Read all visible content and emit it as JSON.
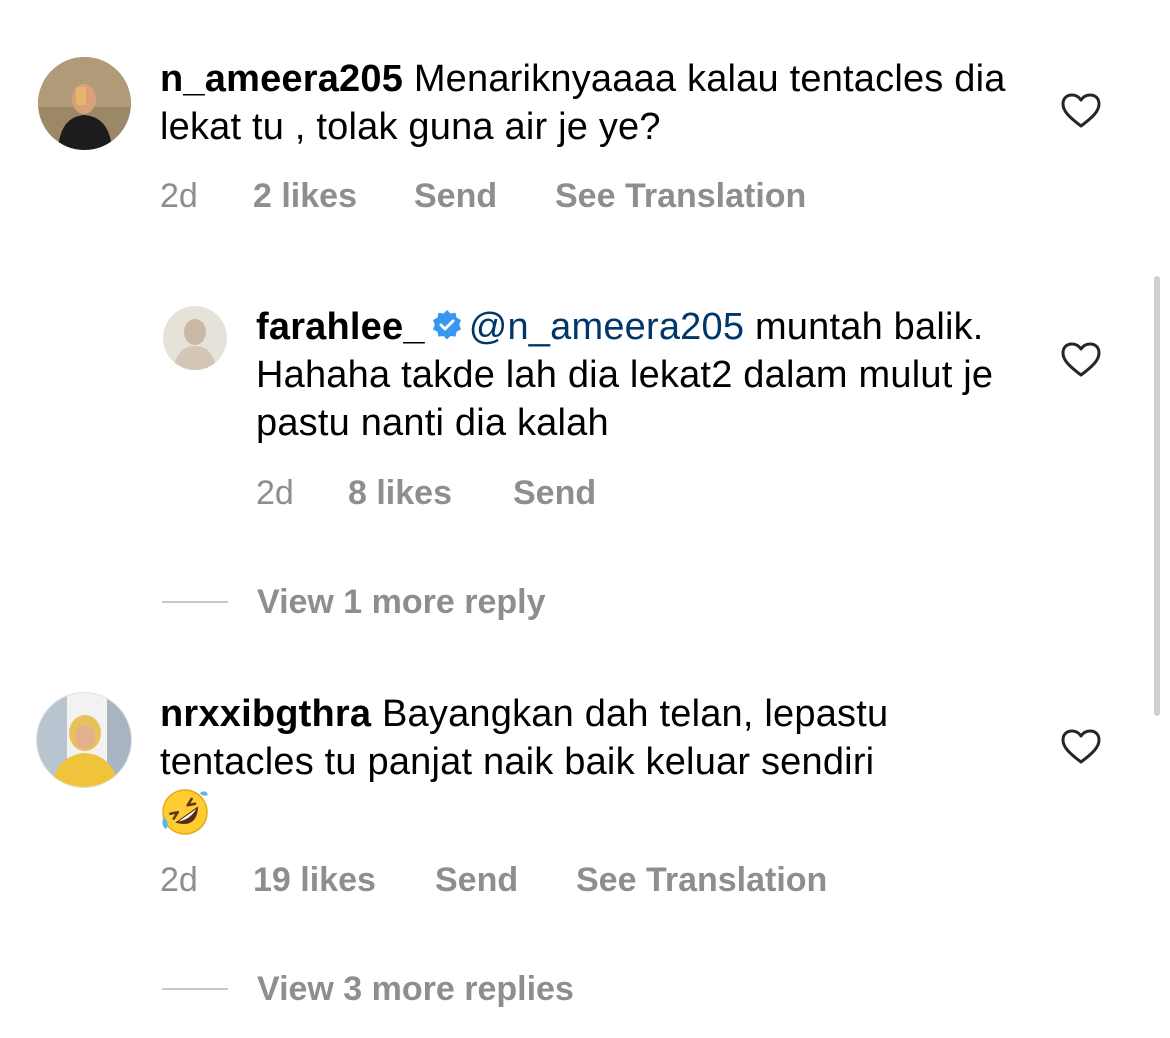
{
  "comments": [
    {
      "username": "n_ameera205",
      "text": "Menariknyaaaa kalau tentacles dia lekat tu , tolak guna air je ye?",
      "time": "2d",
      "likes": "2 likes",
      "send": "Send",
      "translate": "See Translation"
    },
    {
      "username": "farahlee_",
      "verified": true,
      "mention": "@n_ameera205",
      "text": "muntah balik. Hahaha takde lah dia lekat2 dalam mulut je pastu nanti dia kalah",
      "time": "2d",
      "likes": "8 likes",
      "send": "Send",
      "view_replies": "View 1 more reply"
    },
    {
      "username": "nrxxibgthra",
      "text": "Bayangkan dah telan, lepastu tentacles tu panjat naik baik keluar sendiri",
      "emoji": "rolling-on-floor-laughing",
      "time": "2d",
      "likes": "19 likes",
      "send": "Send",
      "translate": "See Translation",
      "view_replies": "View 3 more replies"
    }
  ],
  "colors": {
    "secondary_text": "#8e8e8e",
    "mention": "#00376b",
    "verified_badge": "#3897f0"
  }
}
